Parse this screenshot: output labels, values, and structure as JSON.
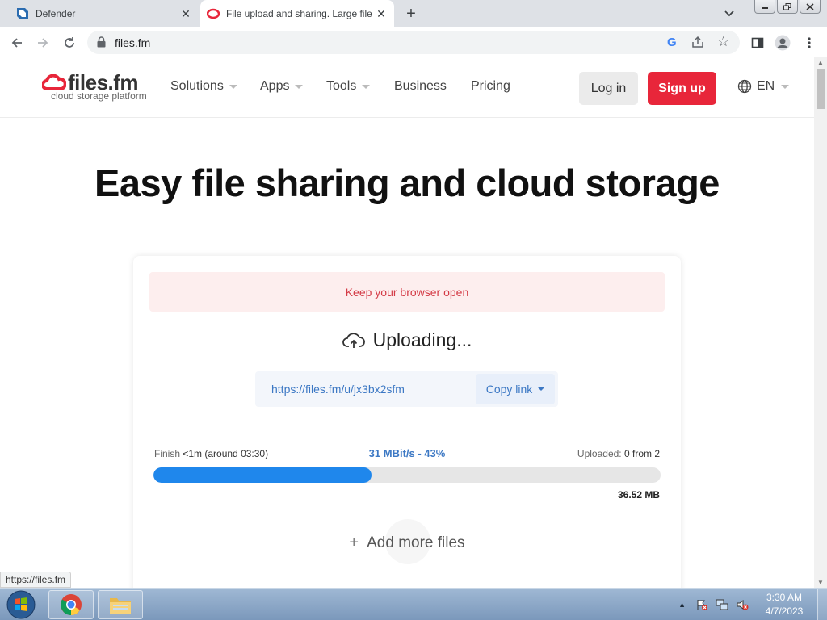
{
  "browser": {
    "tabs": [
      {
        "title": "Defender",
        "close": "✕"
      },
      {
        "title": "File upload and sharing. Large file",
        "close": "✕"
      }
    ],
    "new_tab": "+",
    "address": "files.fm"
  },
  "site": {
    "logo_word": "files.fm",
    "logo_tagline": "cloud storage platform",
    "nav": [
      {
        "label": "Solutions",
        "has_dropdown": true
      },
      {
        "label": "Apps",
        "has_dropdown": true
      },
      {
        "label": "Tools",
        "has_dropdown": true
      },
      {
        "label": "Business",
        "has_dropdown": false
      },
      {
        "label": "Pricing",
        "has_dropdown": false
      }
    ],
    "login_label": "Log in",
    "signup_label": "Sign up",
    "language": "EN",
    "colors": {
      "brand_red": "#e8263a",
      "link_blue": "#3c78c4",
      "progress_blue": "#1f87ec"
    }
  },
  "hero": {
    "title": "Easy file sharing and cloud storage"
  },
  "upload": {
    "notice": "Keep your browser open",
    "status": "Uploading...",
    "share_link": "https://files.fm/u/jx3bx2sfm",
    "copy_label": "Copy link",
    "finish_label": "Finish",
    "finish_value": "<1m (around 03:30)",
    "speed": "31 MBit/s - 43%",
    "uploaded_label": "Uploaded:",
    "uploaded_value": "0 from 2",
    "progress_percent": 43,
    "total_size": "36.52 MB",
    "add_more_label": "Add more files"
  },
  "status_bar": {
    "hover_url": "https://files.fm"
  },
  "taskbar": {
    "time": "3:30 AM",
    "date": "4/7/2023"
  }
}
